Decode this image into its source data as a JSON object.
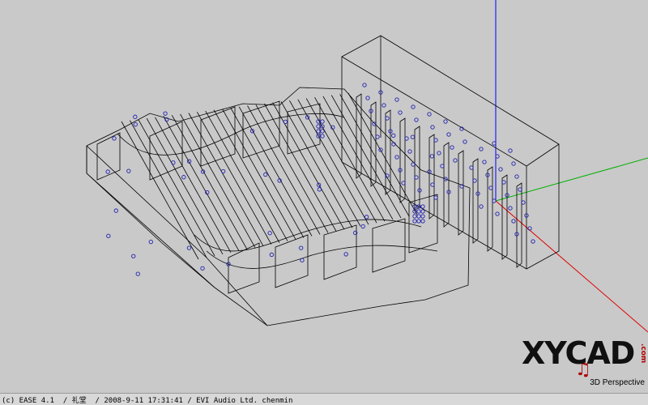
{
  "viewport": {
    "view_mode": "3D Perspective",
    "axis_colors": {
      "x": "#e00000",
      "y": "#00b000",
      "z": "#0000ff"
    },
    "wire_color": "#000000",
    "source_color": "#2020b0"
  },
  "logo": {
    "text": "XYCAD",
    "suffix": ".com"
  },
  "status_bar": {
    "text": "(c) EASE 4.1  / 礼堂  / 2008-9-11 17:31:41 / EVI Audio Ltd. chenmin"
  }
}
